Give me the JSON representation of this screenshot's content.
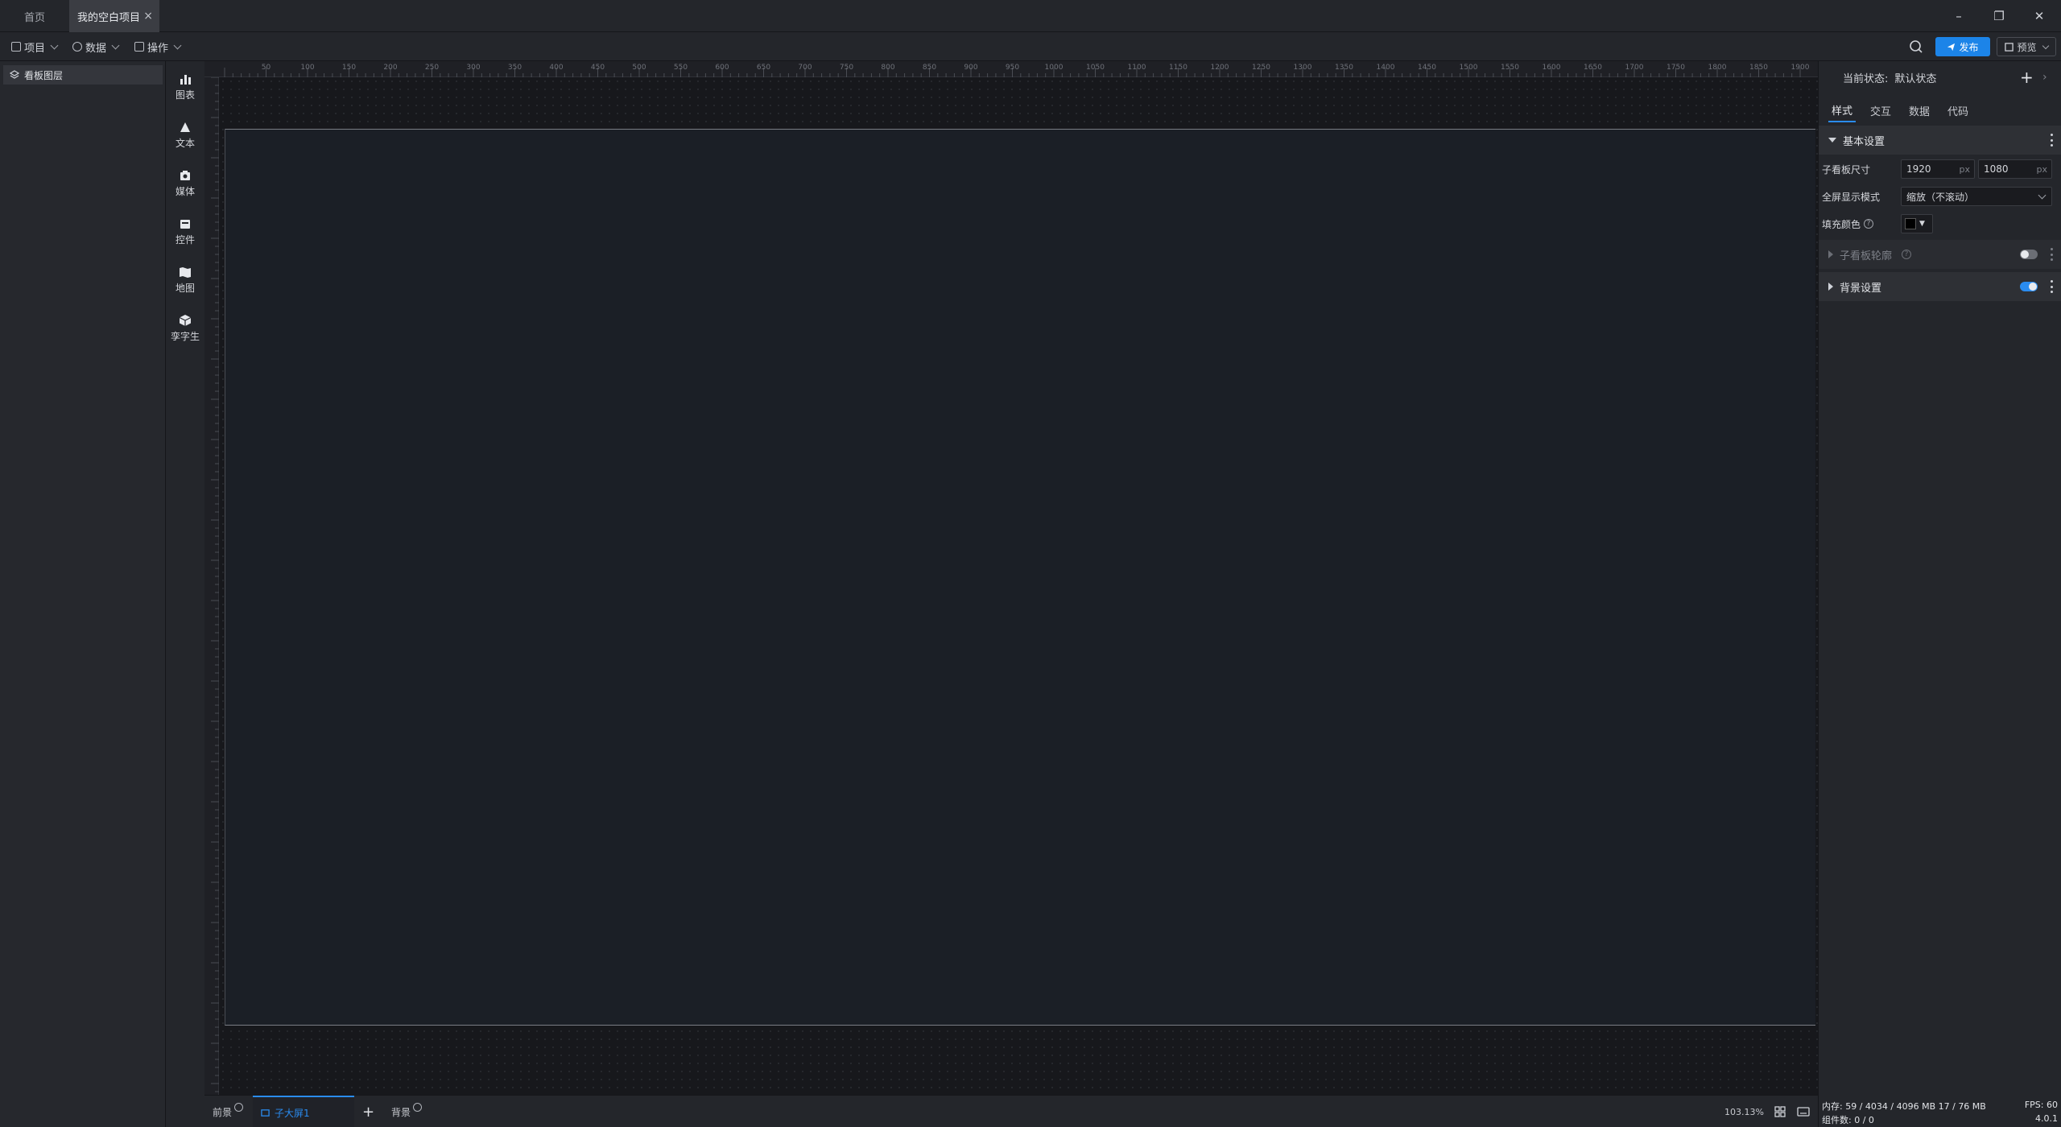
{
  "tabs": {
    "home": "首页",
    "project": "我的空白项目",
    "close_glyph": "×"
  },
  "window": {
    "minimize": "–",
    "restore": "❐",
    "close": "✕"
  },
  "toolbar": {
    "menus": [
      "项目",
      "数据",
      "操作"
    ],
    "publish_label": "发布",
    "preview_label": "预览"
  },
  "layers": {
    "title": "看板图层"
  },
  "components": [
    "图表",
    "文本",
    "媒体",
    "控件",
    "地图",
    "孪字生"
  ],
  "ruler": {
    "h_ticks": [
      "50",
      "100",
      "150",
      "200",
      "250",
      "300",
      "350",
      "400",
      "450",
      "500",
      "550",
      "600",
      "650",
      "700",
      "750",
      "800",
      "850",
      "900",
      "950",
      "1000",
      "1050",
      "1100",
      "1150",
      "1200",
      "1250",
      "1300",
      "1350",
      "1400",
      "1450",
      "1500",
      "1550",
      "1600",
      "1650",
      "1700",
      "1750",
      "1800",
      "1850",
      "1900"
    ]
  },
  "bottom": {
    "front": "前景",
    "sub": "子大屏1",
    "add": "+",
    "back": "背景",
    "zoom": "103.13%"
  },
  "props": {
    "status_label": "当前状态:",
    "status_value": "默认状态",
    "tabs": [
      "样式",
      "交互",
      "数据",
      "代码"
    ],
    "basic_section": "基本设置",
    "size_label": "子看板尺寸",
    "width": "1920",
    "height": "1080",
    "unit": "px",
    "fullscreen_label": "全屏显示模式",
    "fullscreen_value": "缩放（不滚动）",
    "fill_label": "填充颜色",
    "fill_color": "#000000",
    "outline_section": "子看板轮廓",
    "bg_section": "背景设置",
    "outline_enabled": false,
    "bg_enabled": true
  },
  "statusbar": {
    "memory": "内存: 59 / 4034 / 4096 MB  17 / 76 MB",
    "fps": "FPS: 60",
    "components": "组件数: 0 / 0",
    "version": "4.0.1"
  },
  "colors": {
    "accent": "#1c84e8",
    "board": "#1b1f26"
  }
}
